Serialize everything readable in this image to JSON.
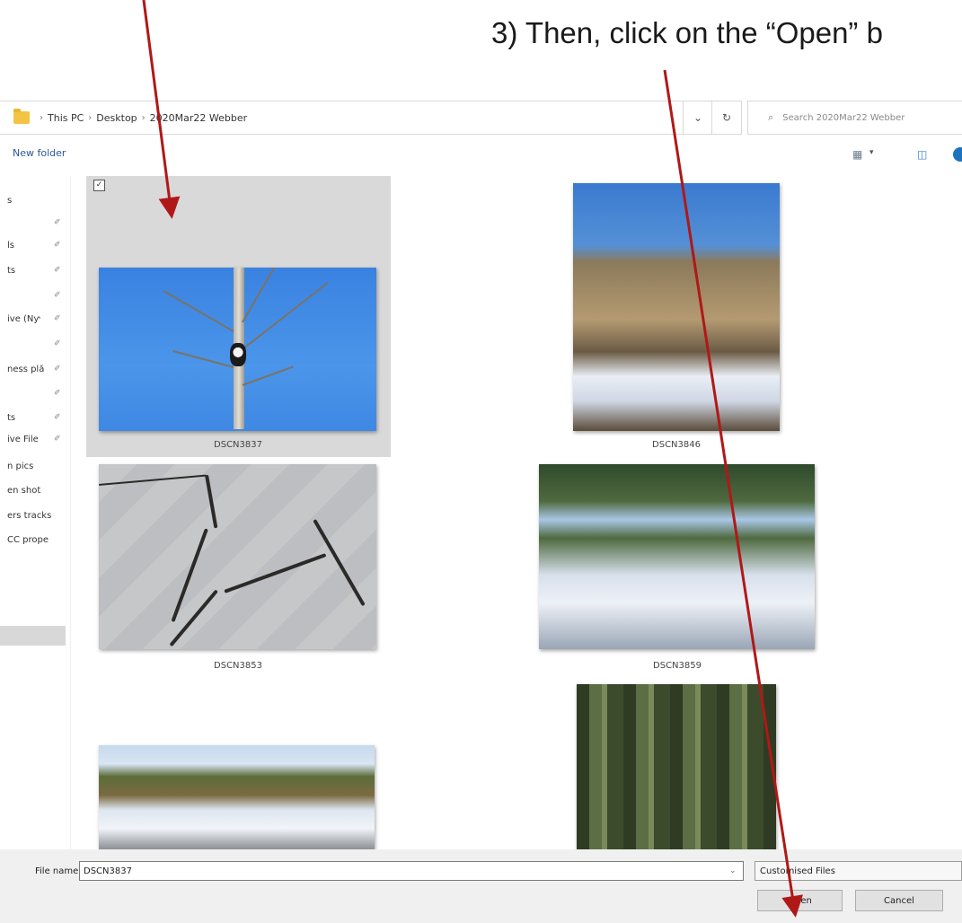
{
  "instruction": {
    "text": "3)  Then, click on the “Open” b"
  },
  "breadcrumb": {
    "items": [
      "This PC",
      "Desktop",
      "2020Mar22 Webber"
    ]
  },
  "search": {
    "placeholder": "Search 2020Mar22 Webber"
  },
  "toolbar": {
    "new_folder": "New folder"
  },
  "sidebar": {
    "items": [
      "s",
      "",
      "ls",
      "ts",
      "",
      "ive (Nƴ",
      "",
      "ness plă",
      "",
      "ts",
      "ive File",
      "n pics",
      "en shot",
      "ers tracks",
      "CC prope"
    ]
  },
  "files": [
    {
      "name": "DSCN3837",
      "selected": true
    },
    {
      "name": "DSCN3846",
      "selected": false
    },
    {
      "name": "DSCN3853",
      "selected": false
    },
    {
      "name": "DSCN3859",
      "selected": false
    },
    {
      "name": "",
      "selected": false
    },
    {
      "name": "",
      "selected": false
    }
  ],
  "footer": {
    "file_name_label": "File name:",
    "file_name_value": "DSCN3837",
    "filter": "Customised Files",
    "open": "Open",
    "cancel": "Cancel"
  },
  "colors": {
    "annotation_arrow": "#b01818",
    "selection": "#d9d9d9",
    "link": "#2b5797"
  }
}
